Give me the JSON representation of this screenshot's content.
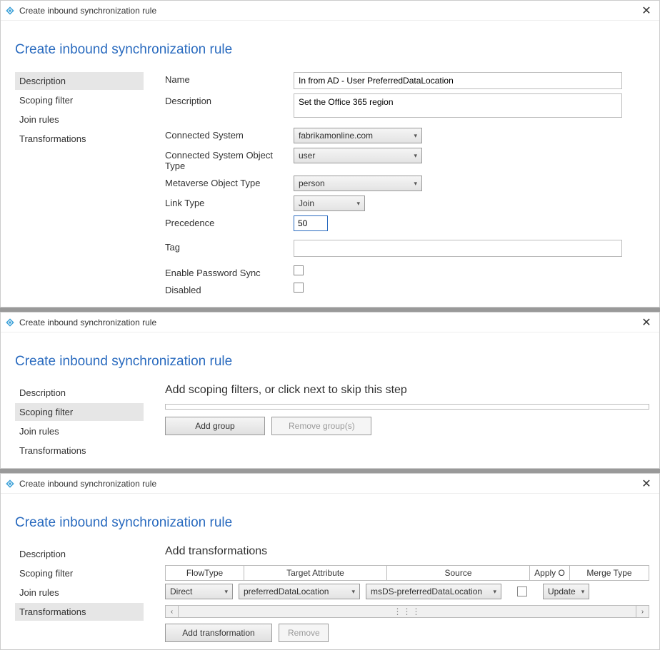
{
  "colors": {
    "accent": "#2a6bbf"
  },
  "windows": [
    {
      "title": "Create inbound synchronization rule",
      "heading": "Create inbound synchronization rule",
      "sidebarSelected": 0,
      "sidebar": [
        "Description",
        "Scoping filter",
        "Join rules",
        "Transformations"
      ],
      "form": {
        "nameLabel": "Name",
        "nameValue": "In from AD - User PreferredDataLocation",
        "descLabel": "Description",
        "descValue": "Set the Office 365 region",
        "connSysLabel": "Connected System",
        "connSysValue": "fabrikamonline.com",
        "connSysObjTypeLabel": "Connected System Object Type",
        "connSysObjTypeValue": "user",
        "mvObjTypeLabel": "Metaverse Object Type",
        "mvObjTypeValue": "person",
        "linkTypeLabel": "Link Type",
        "linkTypeValue": "Join",
        "precedenceLabel": "Precedence",
        "precedenceValue": "50",
        "tagLabel": "Tag",
        "tagValue": "",
        "enablePwLabel": "Enable Password Sync",
        "disabledLabel": "Disabled"
      }
    },
    {
      "title": "Create inbound synchronization rule",
      "heading": "Create inbound synchronization rule",
      "sidebarSelected": 1,
      "sidebar": [
        "Description",
        "Scoping filter",
        "Join rules",
        "Transformations"
      ],
      "scoping": {
        "heading": "Add scoping filters, or click next to skip this step",
        "addGroupLabel": "Add group",
        "removeGroupsLabel": "Remove group(s)"
      }
    },
    {
      "title": "Create inbound synchronization rule",
      "heading": "Create inbound synchronization rule",
      "sidebarSelected": 3,
      "sidebar": [
        "Description",
        "Scoping filter",
        "Join rules",
        "Transformations"
      ],
      "trans": {
        "heading": "Add transformations",
        "headers": {
          "flowType": "FlowType",
          "targetAttr": "Target Attribute",
          "source": "Source",
          "applyOnce": "Apply O",
          "mergeType": "Merge Type"
        },
        "row": {
          "flowType": "Direct",
          "targetAttr": "preferredDataLocation",
          "source": "msDS-preferredDataLocation",
          "mergeType": "Update"
        },
        "addTransLabel": "Add transformation",
        "removeLabel": "Remove"
      }
    }
  ]
}
